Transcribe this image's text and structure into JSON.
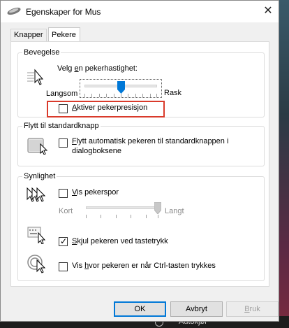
{
  "window": {
    "title": "Egenskaper for Mus",
    "close_glyph": "✕"
  },
  "tabs": [
    {
      "label": "Knapper",
      "active": false
    },
    {
      "label": "Pekere",
      "active": true
    }
  ],
  "motion": {
    "group_label": "Bevegelse",
    "speed_prompt_prefix": "Velg ",
    "speed_prompt_mnemonic": "e",
    "speed_prompt_suffix": "n pekerhastighet:",
    "slow_label": "Langsom",
    "fast_label": "Rask",
    "speed_level": 0.5,
    "precision_checkbox": {
      "mnemonic": "A",
      "label_rest": "ktiver pekerpresisjon",
      "checked": false
    }
  },
  "snap_to": {
    "group_label": "Flytt til standardknapp",
    "checkbox": {
      "mnemonic": "F",
      "line1_rest": "lytt automatisk pekeren til standardknappen i",
      "line2": "dialogboksene",
      "checked": false
    }
  },
  "visibility": {
    "group_label": "Synlighet",
    "trails_checkbox": {
      "mnemonic": "V",
      "label_rest": "is pekerspor",
      "checked": false
    },
    "trail_short_label": "Kort",
    "trail_long_label": "Langt",
    "trail_length_level": 1.0,
    "hide_checkbox": {
      "mnemonic": "S",
      "label_rest": "kjul pekeren ved tastetrykk",
      "checked": true
    },
    "show_location_checkbox": {
      "label_prefix": "Vis ",
      "mnemonic": "h",
      "label_rest": "vor pekeren er når Ctrl-tasten trykkes",
      "checked": false
    }
  },
  "buttons": {
    "ok": "OK",
    "cancel": "Avbryt",
    "apply_mnemonic": "B",
    "apply_rest": "ruk"
  },
  "background": {
    "taskbar_text": "Autokjør"
  },
  "colors": {
    "highlight_box": "#d93a2b",
    "default_button_border": "#0078d7",
    "slider_thumb": "#0078d7"
  }
}
